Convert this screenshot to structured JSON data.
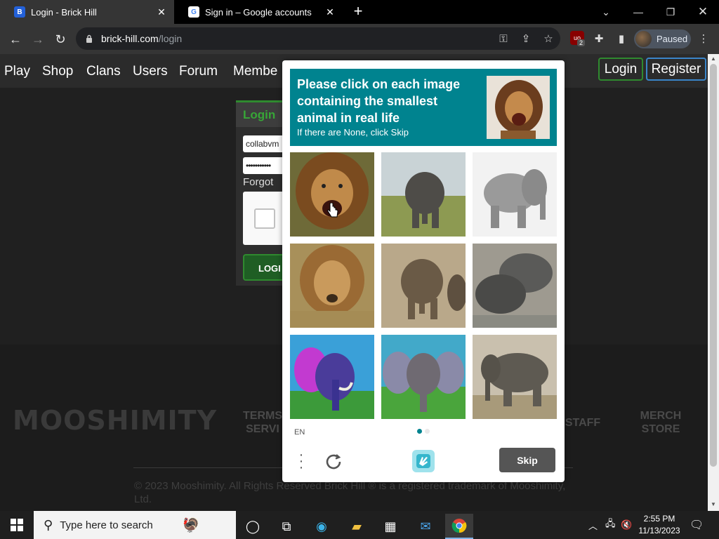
{
  "browser": {
    "tabs": [
      {
        "title": "Login - Brick Hill",
        "favicon": "brick-hill-icon",
        "active": true
      },
      {
        "title": "Sign in – Google accounts",
        "favicon": "google-icon",
        "active": false
      }
    ],
    "url_host": "brick-hill.com",
    "url_path": "/login",
    "profile_label": "Paused",
    "extension_badge": "2"
  },
  "site": {
    "nav": [
      "Play",
      "Shop",
      "Clans",
      "Users",
      "Forum",
      "Membe"
    ],
    "login_button": "Login",
    "register_button": "Register",
    "login_card": {
      "header": "Login",
      "username_value": "collabvm",
      "password_value": "•••••••••••",
      "forgot": "Forgot",
      "submit": "LOGI"
    },
    "footer": {
      "logo": "MOOSHIMITY",
      "links": [
        "TERMS\nSERVI",
        "STAFF",
        "MERCH\nSTORE"
      ],
      "copyright": "© 2023 Mooshimity. All Rights Reserved Brick Hill ® is a registered trademark of Mooshimity, Ltd."
    }
  },
  "captcha": {
    "prompt": "Please click on each image containing the smallest animal in real life",
    "subprompt": "If there are None, click Skip",
    "language": "EN",
    "skip_label": "Skip",
    "tiles": [
      "lion",
      "elephant",
      "elephant",
      "lion",
      "elephant",
      "elephant",
      "elephant",
      "elephant",
      "elephant"
    ]
  },
  "taskbar": {
    "search_placeholder": "Type here to search",
    "time": "2:55 PM",
    "date": "11/13/2023"
  },
  "colors": {
    "captcha_teal": "#00838f",
    "brickhill_green": "#2f8a2f",
    "skip_gray": "#555555"
  }
}
